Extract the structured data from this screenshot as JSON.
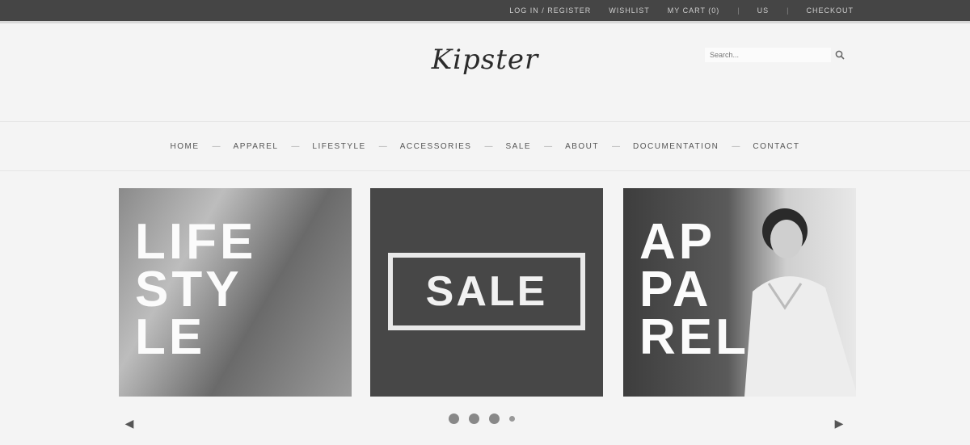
{
  "topbar": {
    "links": [
      "Log In / Register",
      "Wishlist",
      "My Cart (0)",
      "US",
      "Checkout"
    ]
  },
  "header": {
    "logo_text": "Kipster",
    "search_placeholder": "Search..."
  },
  "nav": {
    "items": [
      "Home",
      "Apparel",
      "Lifestyle",
      "Accessories",
      "Sale",
      "About",
      "Documentation",
      "Contact"
    ]
  },
  "slides": [
    {
      "lines": [
        "LIFE",
        "STY",
        "LE"
      ]
    },
    {
      "text": "SALE"
    },
    {
      "lines": [
        "AP",
        "PA",
        "REL"
      ]
    }
  ],
  "carousel": {
    "dot_count": 4,
    "active_index": 0
  }
}
